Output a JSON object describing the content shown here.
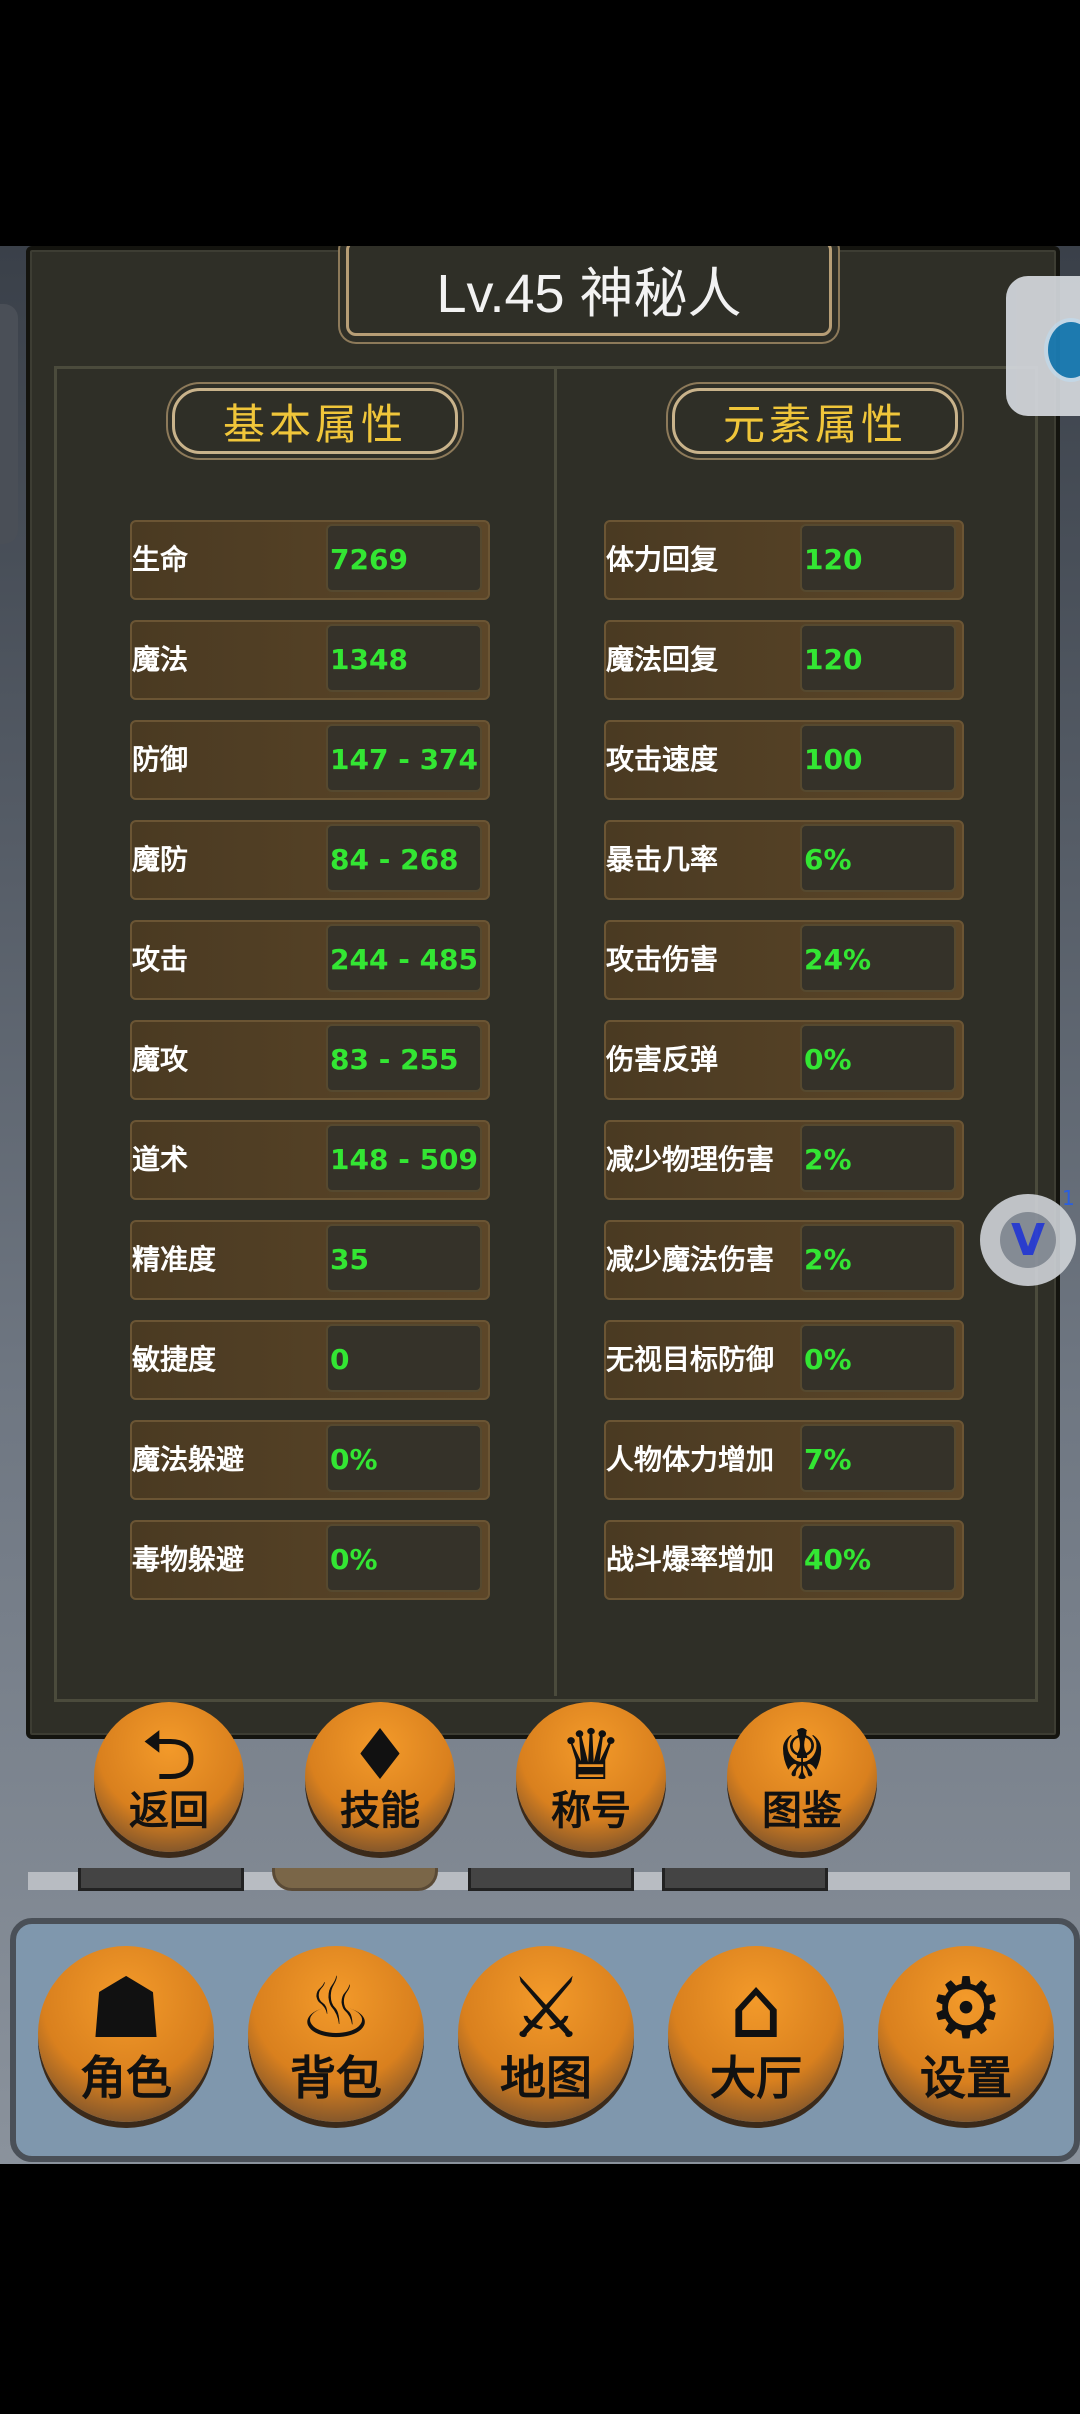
{
  "title": "Lv.45 神秘人",
  "sections": {
    "basic": "基本属性",
    "element": "元素属性"
  },
  "basic_stats": [
    {
      "label": "生命",
      "value": "7269"
    },
    {
      "label": "魔法",
      "value": "1348"
    },
    {
      "label": "防御",
      "value": "147 - 374"
    },
    {
      "label": "魔防",
      "value": "84 - 268"
    },
    {
      "label": "攻击",
      "value": "244 - 485"
    },
    {
      "label": "魔攻",
      "value": "83 - 255"
    },
    {
      "label": "道术",
      "value": "148 - 509"
    },
    {
      "label": "精准度",
      "value": "35"
    },
    {
      "label": "敏捷度",
      "value": "0"
    },
    {
      "label": "魔法躲避",
      "value": "0%"
    },
    {
      "label": "毒物躲避",
      "value": "0%"
    }
  ],
  "element_stats": [
    {
      "label": "体力回复",
      "value": "120"
    },
    {
      "label": "魔法回复",
      "value": "120"
    },
    {
      "label": "攻击速度",
      "value": "100"
    },
    {
      "label": "暴击几率",
      "value": "6%"
    },
    {
      "label": "攻击伤害",
      "value": "24%"
    },
    {
      "label": "伤害反弹",
      "value": "0%"
    },
    {
      "label": "减少物理伤害",
      "value": "2%"
    },
    {
      "label": "减少魔法伤害",
      "value": "2%"
    },
    {
      "label": "无视目标防御",
      "value": "0%"
    },
    {
      "label": "人物体力增加",
      "value": "7%"
    },
    {
      "label": "战斗爆率增加",
      "value": "40%"
    }
  ],
  "actions": [
    {
      "label": "返回",
      "glyph": "⮌",
      "icon": "back-arrow-icon"
    },
    {
      "label": "技能",
      "glyph": "♦",
      "icon": "skill-crest-icon"
    },
    {
      "label": "称号",
      "glyph": "♛",
      "icon": "crown-icon"
    },
    {
      "label": "图鉴",
      "glyph": "☬",
      "icon": "dragon-icon"
    }
  ],
  "nav": [
    {
      "label": "角色",
      "glyph": "☗",
      "icon": "wizard-icon"
    },
    {
      "label": "背包",
      "glyph": "♨",
      "icon": "bag-icon"
    },
    {
      "label": "地图",
      "glyph": "⚔",
      "icon": "crossed-swords-icon"
    },
    {
      "label": "大厅",
      "glyph": "⌂",
      "icon": "house-icon"
    },
    {
      "label": "设置",
      "glyph": "⚙",
      "icon": "gear-icon"
    }
  ],
  "floating_badge": "1",
  "floating_glyph": "V"
}
